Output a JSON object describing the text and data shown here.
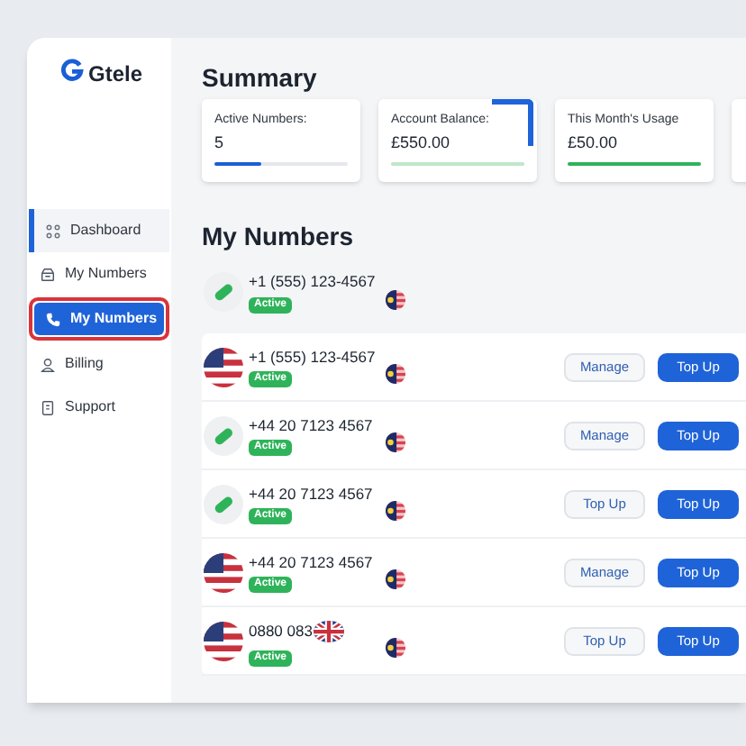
{
  "brand": {
    "name": "Gtele"
  },
  "sidebar": {
    "items": [
      {
        "label": "Dashboard",
        "selected": false,
        "accent": true,
        "highlighted": false
      },
      {
        "label": "My Numbers",
        "selected": false,
        "accent": false,
        "highlighted": false
      },
      {
        "label": "My Numbers",
        "selected": true,
        "accent": false,
        "highlighted": true
      },
      {
        "label": "Billing",
        "selected": false,
        "accent": false,
        "highlighted": false
      },
      {
        "label": "Support",
        "selected": false,
        "accent": false,
        "highlighted": false
      }
    ]
  },
  "summary": {
    "title": "Summary",
    "cards": [
      {
        "label": "Active Numbers:",
        "value": "5",
        "level": 0.35,
        "color": "#1a5fd6",
        "corner": false
      },
      {
        "label": "Account Balance:",
        "value": "£550.00",
        "level": 1,
        "color": "#bfe8c9",
        "corner": true
      },
      {
        "label": "This Month's Usage",
        "value": "£50.00",
        "level": 1,
        "color": "#2fb35a",
        "corner": false
      },
      {
        "kind": "cut"
      }
    ]
  },
  "numbers": {
    "title": "My Numbers",
    "rows": [
      {
        "kind": "pill",
        "number": "+1 (555) 123-4567",
        "status": "Active",
        "in_card": false,
        "buttons": []
      },
      {
        "kind": "flag",
        "number": "+1 (555) 123-4567",
        "status": "Active",
        "in_card": true,
        "buttons": [
          {
            "label": "Manage",
            "kind": "outline"
          },
          {
            "label": "Top Up",
            "kind": "primary"
          }
        ]
      },
      {
        "kind": "pill",
        "number": "+44 20 7123 4567",
        "status": "Active",
        "in_card": true,
        "buttons": [
          {
            "label": "Manage",
            "kind": "outline"
          },
          {
            "label": "Top Up",
            "kind": "primary"
          }
        ]
      },
      {
        "kind": "pill",
        "number": "+44 20 7123 4567",
        "status": "Active",
        "in_card": true,
        "buttons": [
          {
            "label": "Top Up",
            "kind": "outline"
          },
          {
            "label": "Top Up",
            "kind": "primary"
          }
        ]
      },
      {
        "kind": "flag",
        "number": "+44 20 7123 4567",
        "status": "Active",
        "in_card": true,
        "buttons": [
          {
            "label": "Manage",
            "kind": "outline"
          },
          {
            "label": "Top Up",
            "kind": "primary"
          }
        ]
      },
      {
        "kind": "uk",
        "number": "0880 083",
        "status": "Active",
        "in_card": true,
        "buttons": [
          {
            "label": "Top Up",
            "kind": "outline"
          },
          {
            "label": "Top Up",
            "kind": "primary"
          }
        ]
      }
    ]
  }
}
